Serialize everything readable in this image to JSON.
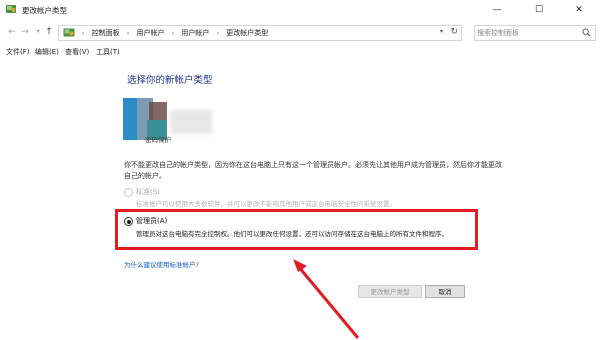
{
  "window": {
    "title": "更改帐户类型",
    "minimize": "—",
    "maximize": "☐",
    "close": "✕"
  },
  "address_bar": {
    "breadcrumbs": [
      "控制面板",
      "用户帐户",
      "用户帐户",
      "更改帐户类型"
    ],
    "search_placeholder": "搜索控制面板"
  },
  "menu": {
    "items": [
      "文件(F)",
      "编辑(E)",
      "查看(V)",
      "工具(T)"
    ]
  },
  "main": {
    "heading": "选择你的新帐户类型",
    "account_subtitle": "密码保护",
    "description": "你不能更改自己的帐户类型，因为你在这台电脑上只有这一个管理员帐户。必须先让其他用户成为管理员，然后你才能更改自己的帐户。",
    "options": {
      "standard": {
        "label": "标准(S)",
        "description": "标准帐户可以使用大多数软件，并可以更改不影响其他用户或这台电脑安全性的系统设置。",
        "selected": false
      },
      "admin": {
        "label": "管理员(A)",
        "description": "管理员对这台电脑有完全控制权。他们可以更改任何设置，还可以访问存储在这台电脑上的所有文件和程序。",
        "selected": true
      }
    },
    "why_link": "为什么建议使用标准帐户?",
    "buttons": {
      "change": "更改帐户类型",
      "cancel": "取消"
    }
  },
  "colors": {
    "highlight": "#e31b23",
    "heading": "#1e3287",
    "link": "#1a5cc4"
  }
}
